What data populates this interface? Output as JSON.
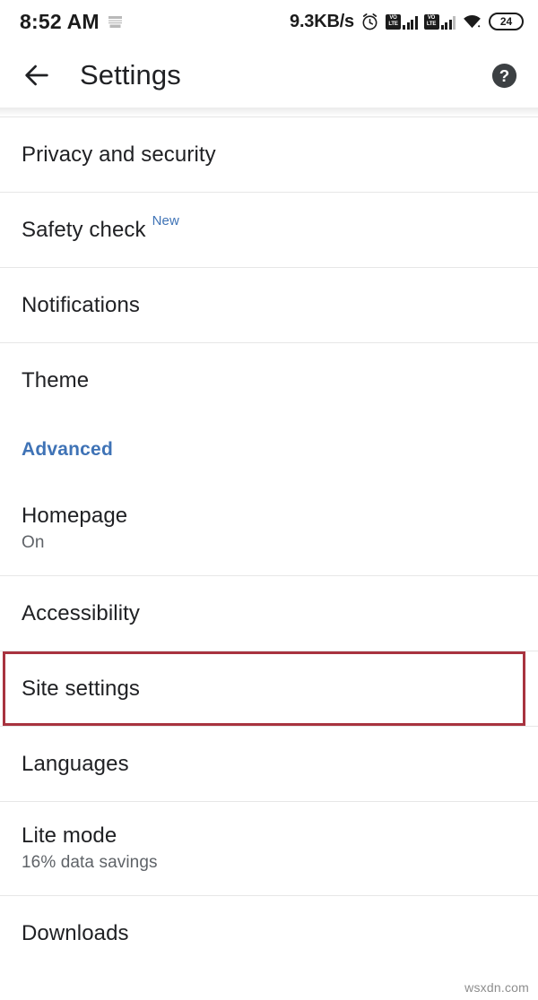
{
  "status_bar": {
    "time": "8:52 AM",
    "network_speed": "9.3KB/s",
    "battery_level": "24",
    "volte_label_top": "VO",
    "volte_label_bottom": "LTE",
    "icons": [
      "sim-card-icon",
      "alarm-clock-icon",
      "volte-signal-icon",
      "volte-signal-icon",
      "wifi-icon",
      "battery-icon"
    ]
  },
  "toolbar": {
    "title": "Settings",
    "back_icon": "back-arrow-icon",
    "help_icon": "help-circle-icon"
  },
  "list": {
    "rows": [
      {
        "title": "Privacy and security",
        "subtitle": "",
        "badge": "",
        "type": "item",
        "highlighted": false
      },
      {
        "title": "Safety check",
        "subtitle": "",
        "badge": "New",
        "type": "item",
        "highlighted": false
      },
      {
        "title": "Notifications",
        "subtitle": "",
        "badge": "",
        "type": "item",
        "highlighted": false
      },
      {
        "title": "Theme",
        "subtitle": "",
        "badge": "",
        "type": "item",
        "highlighted": false
      },
      {
        "title": "Advanced",
        "subtitle": "",
        "badge": "",
        "type": "section",
        "highlighted": false
      },
      {
        "title": "Homepage",
        "subtitle": "On",
        "badge": "",
        "type": "item",
        "highlighted": false
      },
      {
        "title": "Accessibility",
        "subtitle": "",
        "badge": "",
        "type": "item",
        "highlighted": false
      },
      {
        "title": "Site settings",
        "subtitle": "",
        "badge": "",
        "type": "item",
        "highlighted": true
      },
      {
        "title": "Languages",
        "subtitle": "",
        "badge": "",
        "type": "item",
        "highlighted": false
      },
      {
        "title": "Lite mode",
        "subtitle": "16% data savings",
        "badge": "",
        "type": "item",
        "highlighted": false
      },
      {
        "title": "Downloads",
        "subtitle": "",
        "badge": "",
        "type": "item",
        "highlighted": false
      }
    ]
  },
  "highlight": {
    "target": "Site settings",
    "color": "#a8333f"
  },
  "watermark": {
    "text": "wsxdn.com"
  },
  "colors": {
    "accent_blue": "#3f73b6",
    "text_primary": "#202124",
    "text_secondary": "#5f6368",
    "divider": "#e7e7e7",
    "background": "#ffffff",
    "highlight_red": "#a8333f"
  }
}
